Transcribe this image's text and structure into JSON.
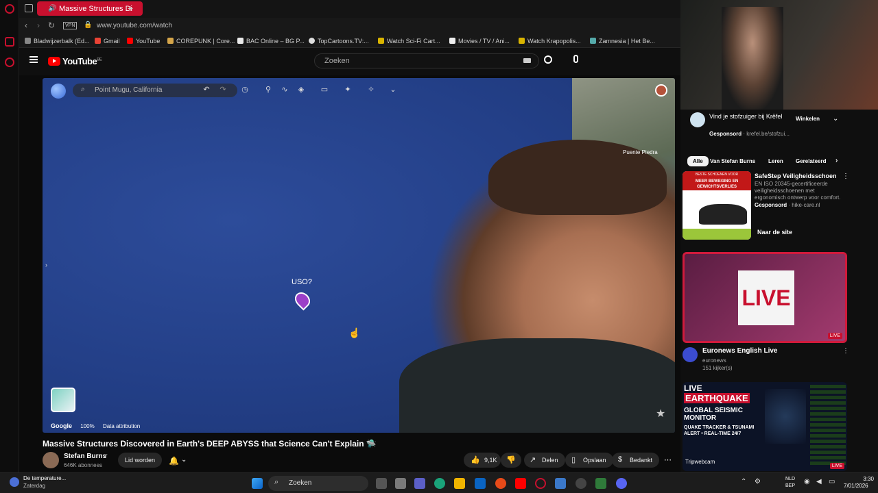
{
  "browser": {
    "tab_title": "Massive Structures Di",
    "url": "www.youtube.com/watch",
    "vpn": "VPN",
    "bookmarks": [
      "Bladwijzerbalk (Ed...",
      "Gmail",
      "YouTube",
      "COREPUNK | Core...",
      "BAC Online – BG P...",
      "TopCartoons.TV:...",
      "Watch Sci-Fi Cart...",
      "Movies / TV / Ani...",
      "Watch Krapopolis...",
      "Zamnesia | Het Be..."
    ]
  },
  "youtube": {
    "logo": "YouTube",
    "country": "BE",
    "search_placeholder": "Zoeken"
  },
  "earth": {
    "search_value": "Point Mugu, California",
    "marker_label": "USO?",
    "place_label": "Puente Piedra",
    "attrib_google": "Google",
    "attrib_zoom": "100%",
    "attrib_data": "Data attribution"
  },
  "video": {
    "title": "Massive Structures Discovered in Earth's DEEP ABYSS that Science Can't Explain 🛸",
    "channel": "Stefan Burns",
    "subscribers": "646K abonnees",
    "join": "Lid worden",
    "likes": "9,1K",
    "share": "Delen",
    "save": "Opslaan",
    "thanks": "Bedankt"
  },
  "sidebar": {
    "ad_top_title": "Vind je stofzuiger bij Krëfel",
    "ad_top_sponsor": "Gesponsord",
    "ad_top_domain": "krefel.be/stofzui...",
    "ad_top_button": "Winkelen",
    "chips": [
      "Alle",
      "Van Stefan Burns",
      "Leren",
      "Gerelateerd"
    ],
    "ad2_title": "SafeStep Veiligheidsschoen",
    "ad2_desc": "EN ISO 20345-gecertificeerde veiligheidsschoenen met ergonomisch ontwerp voor comfort.",
    "ad2_sponsor": "Gesponsord",
    "ad2_domain": "hike-care.nl",
    "ad2_button": "Naar de site",
    "ad2_banner_1": "BESTE SCHOENEN VOOR",
    "ad2_banner_2": "MEER BEWEGING EN GEWICHTSVERLIES",
    "live_text": "LIVE",
    "live_badge": "LIVE",
    "v1_title": "Euronews English Live",
    "v1_channel": "euronews",
    "v1_viewers": "151 kijker(s)",
    "v2_thumb_1": "LIVE",
    "v2_thumb_2": "EARTHQUAKE",
    "v2_thumb_3": "GLOBAL SEISMIC MONITOR",
    "v2_thumb_4": "QUAKE TRACKER & TSUNAMI ALERT • REAL-TIME 24/7",
    "v2_brand": "Tripwebcam",
    "v2_badge": "LIVE"
  },
  "taskbar": {
    "weather_title": "De temperature...",
    "weather_sub": "Zaterdag",
    "search": "Zoeken",
    "lang": "NLD",
    "lang2": "BEP",
    "time": "3:30",
    "date": "7/01/2026"
  }
}
